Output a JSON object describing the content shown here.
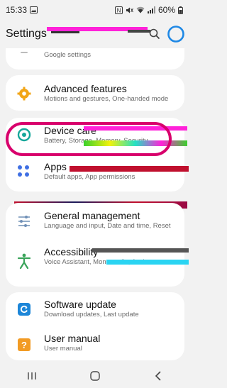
{
  "status": {
    "time": "15:33",
    "battery": "60%"
  },
  "appbar": {
    "title": "Settings"
  },
  "colors": {
    "accent": "#1e88e5",
    "highlight": "#d8006c",
    "advanced": "#f2a516",
    "care": "#15a79a",
    "apps": "#3f6fe3",
    "management": "#6f8fb6",
    "accessibility": "#3aa45a",
    "update": "#1d86d8",
    "manual": "#f29b24"
  },
  "rows": [
    {
      "title": "",
      "subtitle": "Google settings",
      "icon": "google-icon"
    },
    {
      "title": "Advanced features",
      "subtitle": "Motions and gestures, One-handed mode",
      "icon": "advanced-features-icon"
    },
    {
      "title": "Device care",
      "subtitle": "Battery, Storage, Memory, Security",
      "icon": "device-care-icon"
    },
    {
      "title": "Apps",
      "subtitle": "Default apps, App permissions",
      "icon": "apps-icon"
    },
    {
      "title": "General management",
      "subtitle": "Language and input, Date and time, Reset",
      "icon": "general-management-icon"
    },
    {
      "title": "Accessibility",
      "subtitle": "Voice Assistant, Mono audio, Assistant menu",
      "icon": "accessibility-icon"
    },
    {
      "title": "Software update",
      "subtitle": "Download updates, Last update",
      "icon": "software-update-icon"
    },
    {
      "title": "User manual",
      "subtitle": "User manual",
      "icon": "user-manual-icon"
    }
  ]
}
